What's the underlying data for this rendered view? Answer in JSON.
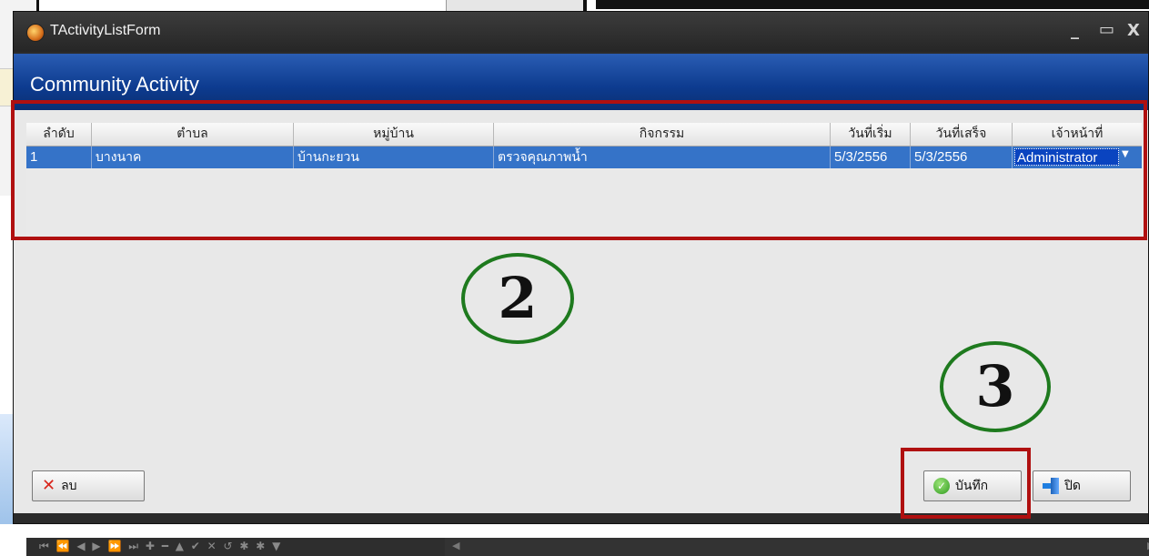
{
  "window": {
    "title": "TActivityListForm",
    "controls": {
      "minimize": "_",
      "maximize": "▭",
      "close": "X"
    }
  },
  "header": {
    "title": "Community Activity"
  },
  "grid": {
    "columns": [
      "ลำดับ",
      "ตำบล",
      "หมู่บ้าน",
      "กิจกรรม",
      "วันที่เริ่ม",
      "วันที่เสร็จ",
      "เจ้าหน้าที่"
    ],
    "rows": [
      {
        "no": "1",
        "subdistrict": "บางนาค",
        "village": "บ้านกะยวน",
        "activity": "ตรวจคุณภาพน้ำ",
        "start": "5/3/2556",
        "end": "5/3/2556",
        "officer": "Administrator"
      }
    ]
  },
  "annotations": {
    "circle_2": "2",
    "circle_3": "3"
  },
  "navigator": {
    "glyphs": "⏮ ⏪ ◀ ▶ ⏩ ⏭ ✚ ━ ▲ ✔ ✕ ↺ ✱ ✱ ▼"
  },
  "buttons": {
    "delete": "ลบ",
    "save": "บันทึก",
    "close": "ปิด"
  },
  "colors": {
    "highlight": "#b01010",
    "annotation_circle": "#1e7a1e",
    "selected_row": "#3573c8",
    "header_bar": "#0d3b8f"
  }
}
